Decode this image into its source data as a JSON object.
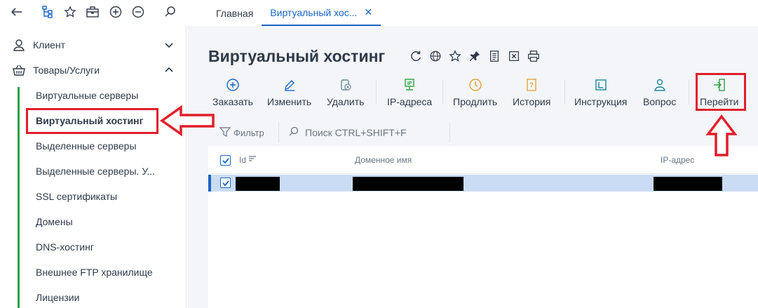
{
  "topbar": {
    "icons": [
      "back-arrow-icon",
      "sitemap-icon",
      "star-icon",
      "briefcase-icon",
      "zoom-in-icon",
      "zoom-out-icon",
      "search-icon"
    ],
    "tabs": [
      {
        "label": "Главная",
        "active": false
      },
      {
        "label": "Виртуальный хос...",
        "active": true,
        "closable": true
      }
    ]
  },
  "sidebar": {
    "groups": [
      {
        "label": "Клиент",
        "icon": "user-icon",
        "expanded": false
      },
      {
        "label": "Товары/Услуги",
        "icon": "basket-icon",
        "expanded": true
      }
    ],
    "items": [
      {
        "label": "Виртуальные серверы"
      },
      {
        "label": "Виртуальный хостинг",
        "active": true
      },
      {
        "label": "Выделенные серверы"
      },
      {
        "label": "Выделенные серверы. У..."
      },
      {
        "label": "SSL сертификаты"
      },
      {
        "label": "Домены"
      },
      {
        "label": "DNS-хостинг"
      },
      {
        "label": "Внешнее FTP хранилище"
      },
      {
        "label": "Лицензии"
      }
    ]
  },
  "main": {
    "title": "Виртуальный хостинг",
    "title_icons": [
      "refresh-icon",
      "globe-icon",
      "star-icon",
      "pin-icon",
      "document-icon",
      "export-excel-icon",
      "print-icon"
    ],
    "toolbar": [
      {
        "label": "Заказать",
        "icon": "plus-circle-icon"
      },
      {
        "label": "Изменить",
        "icon": "pencil-icon"
      },
      {
        "label": "Удалить",
        "icon": "delete-icon"
      },
      {
        "label": "IP-адреса",
        "icon": "ip-icon"
      },
      {
        "label": "Продлить",
        "icon": "clock-icon"
      },
      {
        "label": "История",
        "icon": "history-icon"
      },
      {
        "label": "Инструкция",
        "icon": "instruction-icon"
      },
      {
        "label": "Вопрос",
        "icon": "question-user-icon"
      },
      {
        "label": "Перейти",
        "icon": "goto-icon"
      }
    ],
    "filter": {
      "label": "Фильтр"
    },
    "search": {
      "placeholder": "Поиск CTRL+SHIFT+F"
    },
    "table": {
      "columns": [
        "Id",
        "Доменное имя",
        "IP-адрес"
      ],
      "rows": [
        {
          "selected": true,
          "id": "",
          "domain": "",
          "ip": ""
        }
      ]
    }
  },
  "colors": {
    "accent": "#1c64c4",
    "highlight": "#e01e2b",
    "success": "#2ea043",
    "selected_row": "#c9dcf3"
  }
}
